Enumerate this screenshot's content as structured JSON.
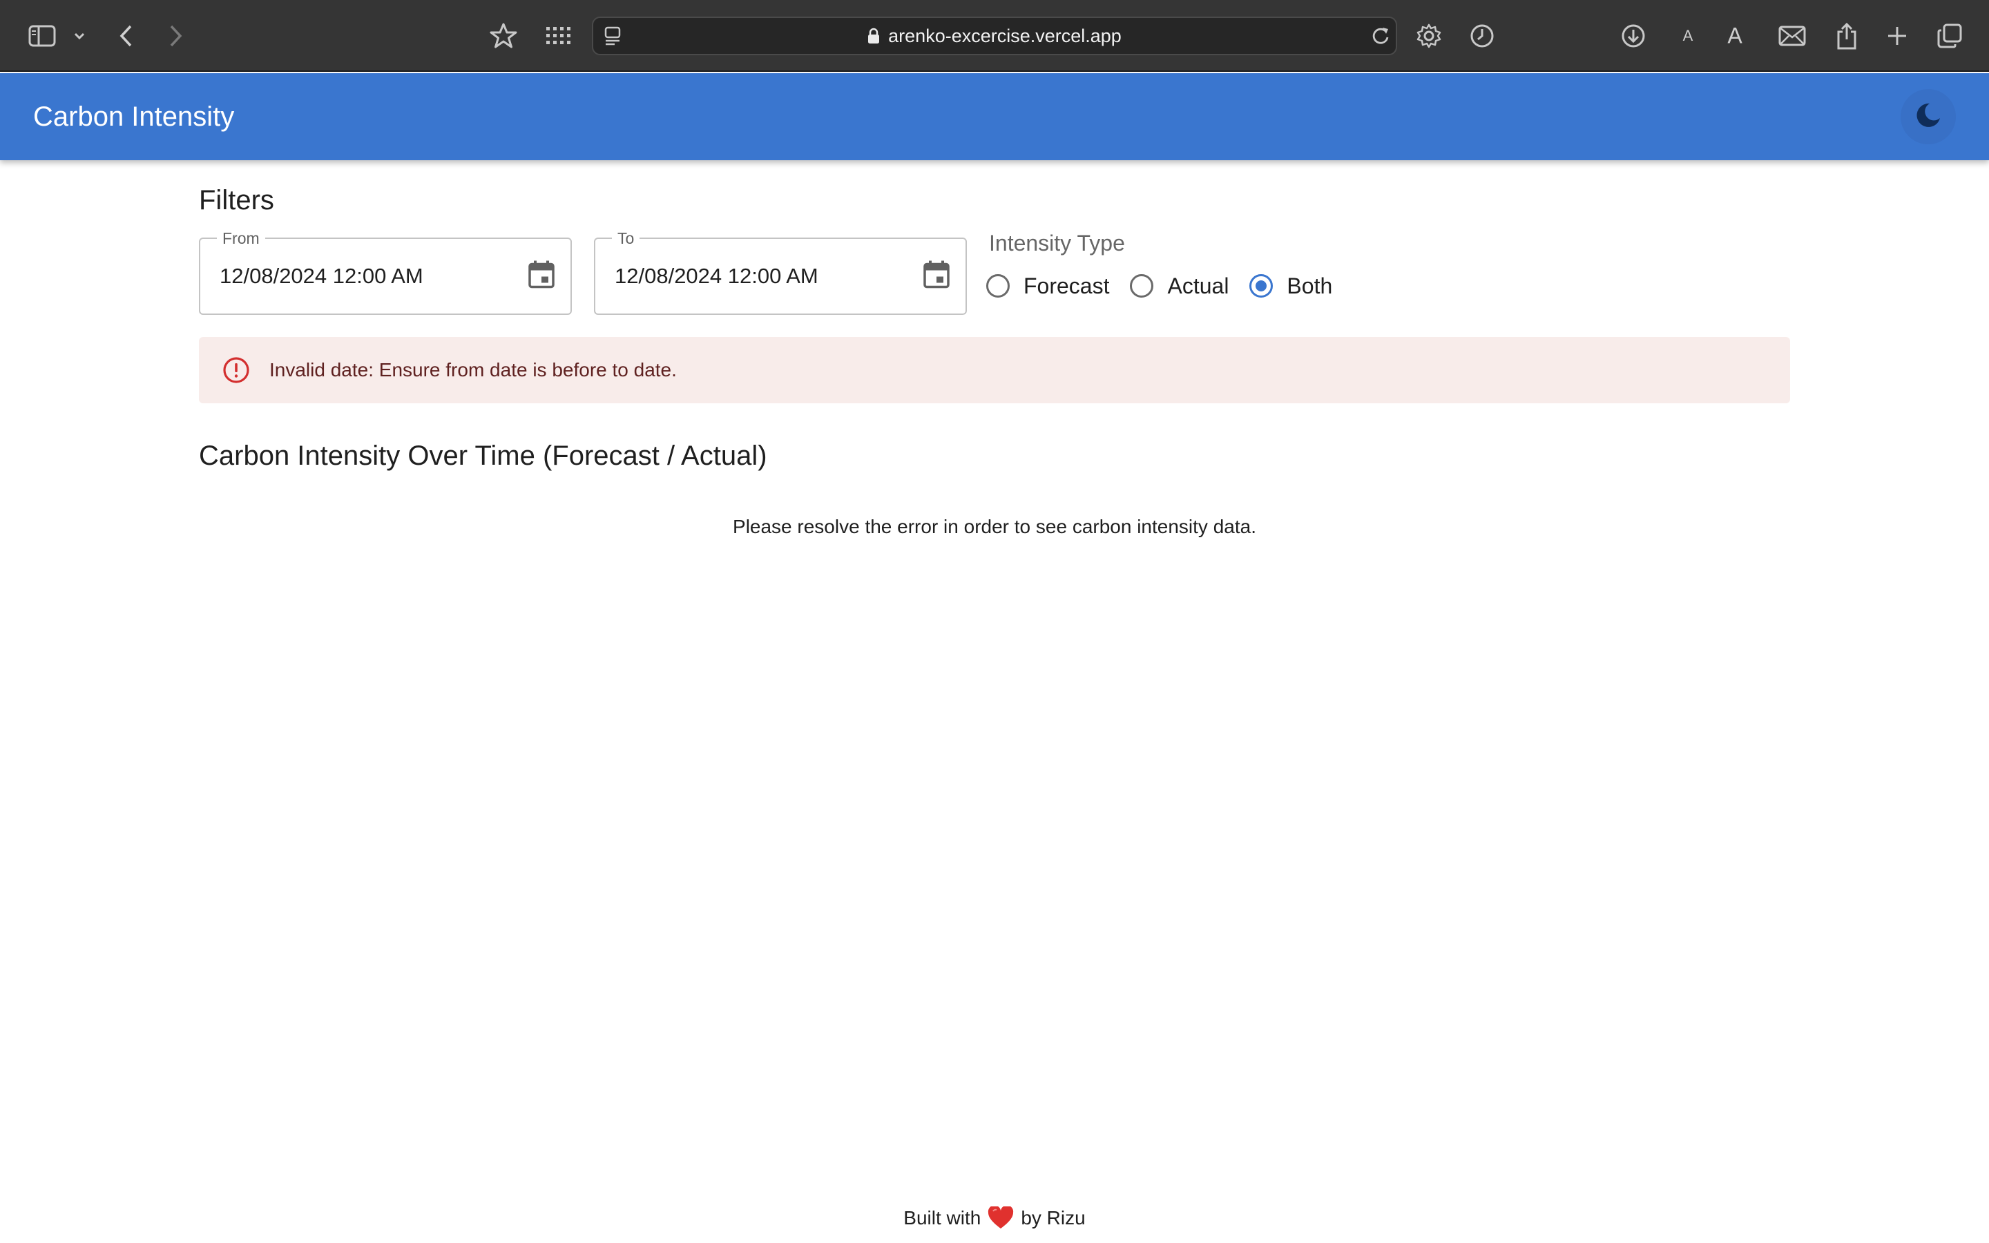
{
  "browser": {
    "url": "arenko-excercise.vercel.app",
    "icons": [
      "sidebar-icon",
      "chevron-down-icon",
      "back-icon",
      "forward-icon",
      "star-icon",
      "grid-icon",
      "tab-overview-icon",
      "lock-icon",
      "reload-icon",
      "gear-icon",
      "history-icon",
      "download-icon",
      "text-smaller-icon",
      "text-larger-icon",
      "mail-icon",
      "share-icon",
      "new-tab-icon",
      "tabs-icon"
    ],
    "text_small": "A",
    "text_large": "A"
  },
  "appbar": {
    "title": "Carbon Intensity",
    "color": "#3a76cf",
    "theme_toggle_icon": "moon-icon"
  },
  "filters": {
    "title": "Filters",
    "from": {
      "label": "From",
      "value": "12/08/2024 12:00 AM"
    },
    "to": {
      "label": "To",
      "value": "12/08/2024 12:00 AM"
    },
    "intensity_type": {
      "label": "Intensity Type",
      "options": [
        "Forecast",
        "Actual",
        "Both"
      ],
      "selected": "Both"
    }
  },
  "alert": {
    "severity": "error",
    "message": "Invalid date: Ensure from date is before to date."
  },
  "chart_section": {
    "title": "Carbon Intensity Over Time (Forecast / Actual)",
    "placeholder": "Please resolve the error in order to see carbon intensity data."
  },
  "footer": {
    "prefix": "Built with",
    "suffix": "by Rizu",
    "heart_icon": "heart-icon"
  }
}
